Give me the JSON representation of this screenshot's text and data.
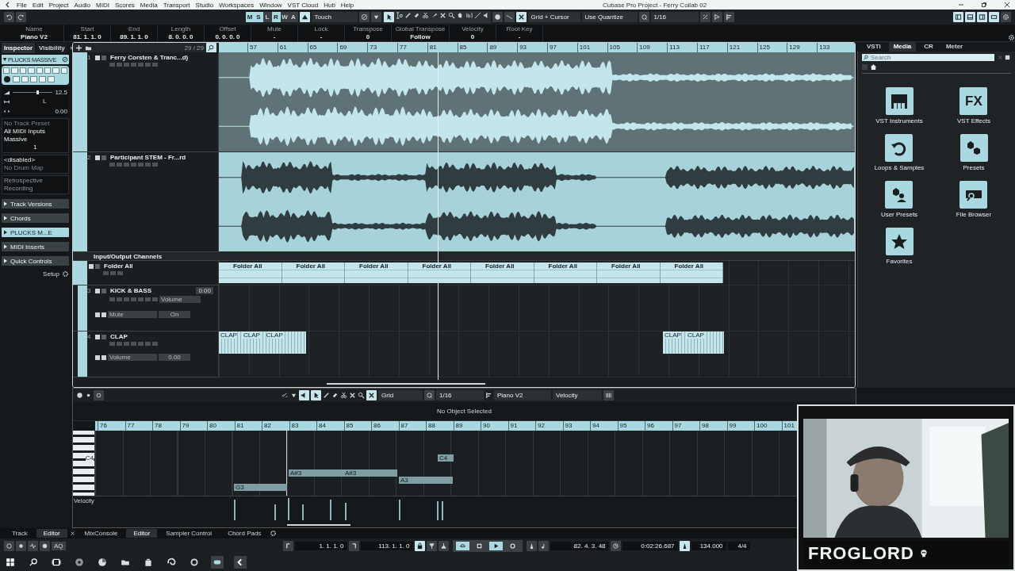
{
  "window": {
    "title": "Cubase Pro Project - Ferry Collab 02"
  },
  "menu": [
    "File",
    "Edit",
    "Project",
    "Audio",
    "MIDI",
    "Scores",
    "Media",
    "Transport",
    "Studio",
    "Workspaces",
    "Window",
    "VST Cloud",
    "Hub",
    "Help"
  ],
  "toolbar": {
    "modes": [
      {
        "label": "M",
        "on": true
      },
      {
        "label": "S",
        "on": true
      },
      {
        "label": "L",
        "on": false
      },
      {
        "label": "R",
        "on": true
      },
      {
        "label": "W",
        "on": false
      },
      {
        "label": "A",
        "on": false
      }
    ],
    "automation_mode": "Touch",
    "snap_type": "Grid + Cursor",
    "quantize_type": "Use Quantize",
    "quantize": "1/16"
  },
  "info_line": [
    {
      "label": "Name",
      "value": "Piano V2"
    },
    {
      "label": "Start",
      "value": "81. 1. 1. 0"
    },
    {
      "label": "End",
      "value": "89. 1. 1. 0"
    },
    {
      "label": "Length",
      "value": "8. 0. 0. 0"
    },
    {
      "label": "Offset",
      "value": "0. 0. 0. 0"
    },
    {
      "label": "Mute",
      "value": "-"
    },
    {
      "label": "Lock",
      "value": "-"
    },
    {
      "label": "Transpose",
      "value": "0"
    },
    {
      "label": "Global Transpose",
      "value": "Follow"
    },
    {
      "label": "Velocity",
      "value": "0"
    },
    {
      "label": "Root Key",
      "value": "-"
    }
  ],
  "inspector": {
    "tabs": [
      {
        "label": "Inspector",
        "selected": true
      },
      {
        "label": "Visibility",
        "selected": false
      }
    ],
    "track_name": "PLUCKS MASSIVE",
    "volume": "12.5",
    "volume_slider": {
      "level": 0.6
    },
    "pan_side": "L",
    "pan": "0.00",
    "routing": [
      {
        "text": "No Track Preset",
        "disabled": true
      },
      {
        "text": "All MIDI Inputs",
        "disabled": false
      },
      {
        "text": "Massive",
        "disabled": false
      }
    ],
    "channel": "1",
    "drum": [
      {
        "text": "<disabled>",
        "disabled": false
      },
      {
        "text": "No Drum Map",
        "disabled": true
      }
    ],
    "retrospective": "Retrospective Recording",
    "sections": [
      {
        "label": "Track Versions",
        "kind": "plain"
      },
      {
        "label": "Chords",
        "kind": "plain"
      },
      {
        "label": "PLUCKS M...E",
        "kind": "highlight"
      },
      {
        "label": "MIDI Inserts",
        "kind": "plain"
      },
      {
        "label": "Quick Controls",
        "kind": "plain"
      }
    ],
    "setup": "Setup"
  },
  "project": {
    "track_count": "29 / 29",
    "ruler": [
      "57",
      "61",
      "65",
      "69",
      "73",
      "77",
      "81",
      "85",
      "89",
      "93",
      "97",
      "101",
      "105",
      "109",
      "113",
      "117",
      "121",
      "125",
      "129",
      "133"
    ],
    "tracks": [
      {
        "kind": "audio",
        "number": "1",
        "name": "Ferry Corsten & Tranc...d)"
      },
      {
        "kind": "audio",
        "number": "2",
        "name": "Participant STEM - Fr...rd"
      },
      {
        "kind": "section",
        "name": "Input/Output Channels"
      },
      {
        "kind": "folder",
        "name": "Folder All",
        "clips": [
          "Folder All",
          "Folder All",
          "Folder All",
          "Folder All",
          "Folder All",
          "Folder All",
          "Folder All",
          "Folder All"
        ]
      },
      {
        "kind": "instrument",
        "number": "3",
        "name": "KICK & BASS",
        "value": "0.00",
        "param": "Volume",
        "lane": [
          "Mute",
          "On"
        ]
      },
      {
        "kind": "instrument",
        "number": "4",
        "name": "CLAP",
        "lane": [
          "Volume",
          "0.00"
        ],
        "clips": [
          [
            "CLAP",
            "CLAP",
            "CLAP"
          ],
          [
            "CLAP",
            "CLAP"
          ]
        ]
      }
    ]
  },
  "right_zone": {
    "tabs": [
      {
        "label": "VSTi",
        "selected": false
      },
      {
        "label": "Media",
        "selected": true
      },
      {
        "label": "CR",
        "selected": false
      },
      {
        "label": "Meter",
        "selected": false
      }
    ],
    "search": {
      "placeholder": "Search"
    },
    "home_checked": false,
    "fx_glyph": "FX",
    "tiles": [
      {
        "kind": "keys",
        "label": "VST Instruments"
      },
      {
        "kind": "fx",
        "label": "VST Effects"
      },
      {
        "kind": "loop",
        "label": "Loops & Samples"
      },
      {
        "kind": "hexes",
        "label": "Presets"
      },
      {
        "kind": "user",
        "label": "User Presets"
      },
      {
        "kind": "browser",
        "label": "File Browser"
      },
      {
        "kind": "star",
        "label": "Favorites"
      }
    ]
  },
  "lower_editor": {
    "snap": "Grid",
    "quantize": "1/16",
    "track": "Piano V2",
    "lane_type": "Velocity",
    "status": "No Object Selected",
    "ruler": [
      "76",
      "77",
      "78",
      "79",
      "80",
      "81",
      "82",
      "83",
      "84",
      "85",
      "86",
      "87",
      "88",
      "89",
      "90",
      "91",
      "92",
      "93",
      "94",
      "95",
      "96",
      "97",
      "98",
      "99",
      "100",
      "101"
    ],
    "key_label": "C4",
    "velocity_label": "Velocity",
    "notes": [
      {
        "label": "G3"
      },
      {
        "label": "A#3"
      },
      {
        "label": "A#3"
      },
      {
        "label": "A3"
      },
      {
        "label": "C4"
      }
    ]
  },
  "zone_tabs": {
    "left": [
      {
        "label": "Track",
        "selected": false
      },
      {
        "label": "Editor",
        "selected": true
      }
    ],
    "lower": [
      {
        "label": "MixConsole",
        "selected": false
      },
      {
        "label": "Editor",
        "selected": true
      },
      {
        "label": "Sampler Control",
        "selected": false
      },
      {
        "label": "Chord Pads",
        "selected": false
      }
    ]
  },
  "transport": {
    "aq": "AQ",
    "left_locator": "1. 1. 1. 0",
    "right_locator": "113. 1. 1. 0",
    "cycle": true,
    "position": "82. 4. 3. 48",
    "time": "0:02:26.687",
    "tempo": "134.000",
    "signature": "4/4"
  },
  "webcam": {
    "name": "FROGLORD"
  }
}
